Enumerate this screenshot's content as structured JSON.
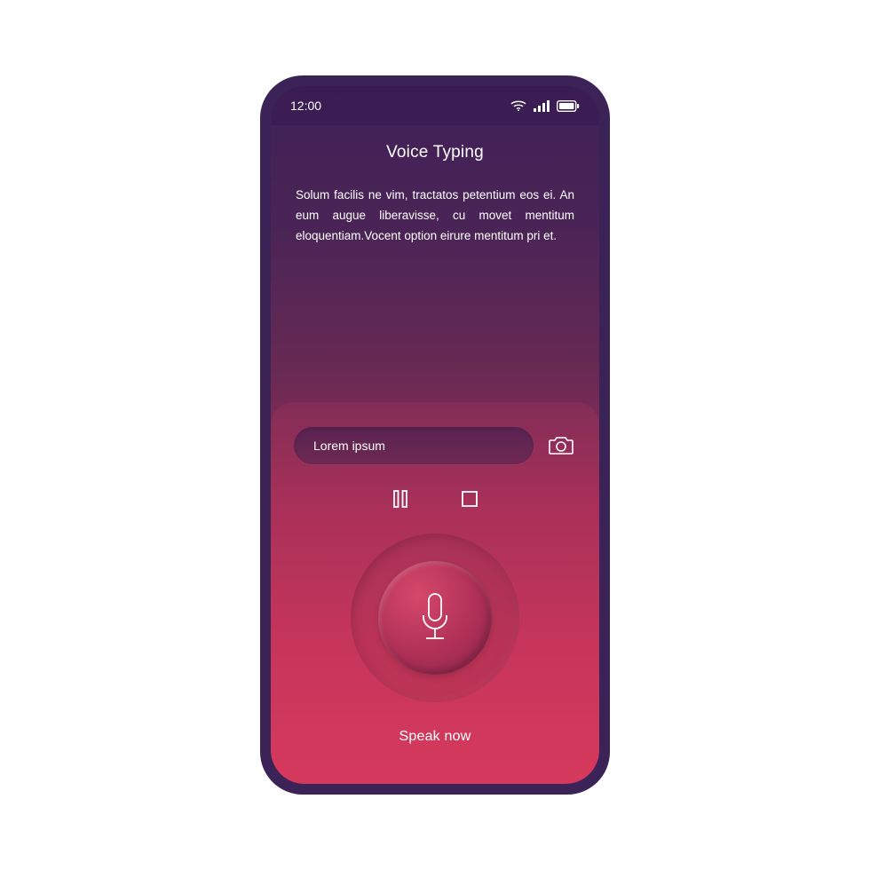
{
  "statusbar": {
    "time": "12:00"
  },
  "header": {
    "title": "Voice Typing"
  },
  "content": {
    "body": "Solum facilis ne vim, tractatos petentium eos ei. An eum augue liberavisse, cu movet mentitum eloquentiam.Vocent option eirure mentitum pri et."
  },
  "input": {
    "placeholder": "Lorem ipsum"
  },
  "prompt": {
    "label": "Speak now"
  },
  "icons": {
    "wifi": "wifi-icon",
    "signal": "signal-icon",
    "battery": "battery-icon",
    "camera": "camera-icon",
    "pause": "pause-icon",
    "stop": "stop-icon",
    "mic": "microphone-icon"
  }
}
